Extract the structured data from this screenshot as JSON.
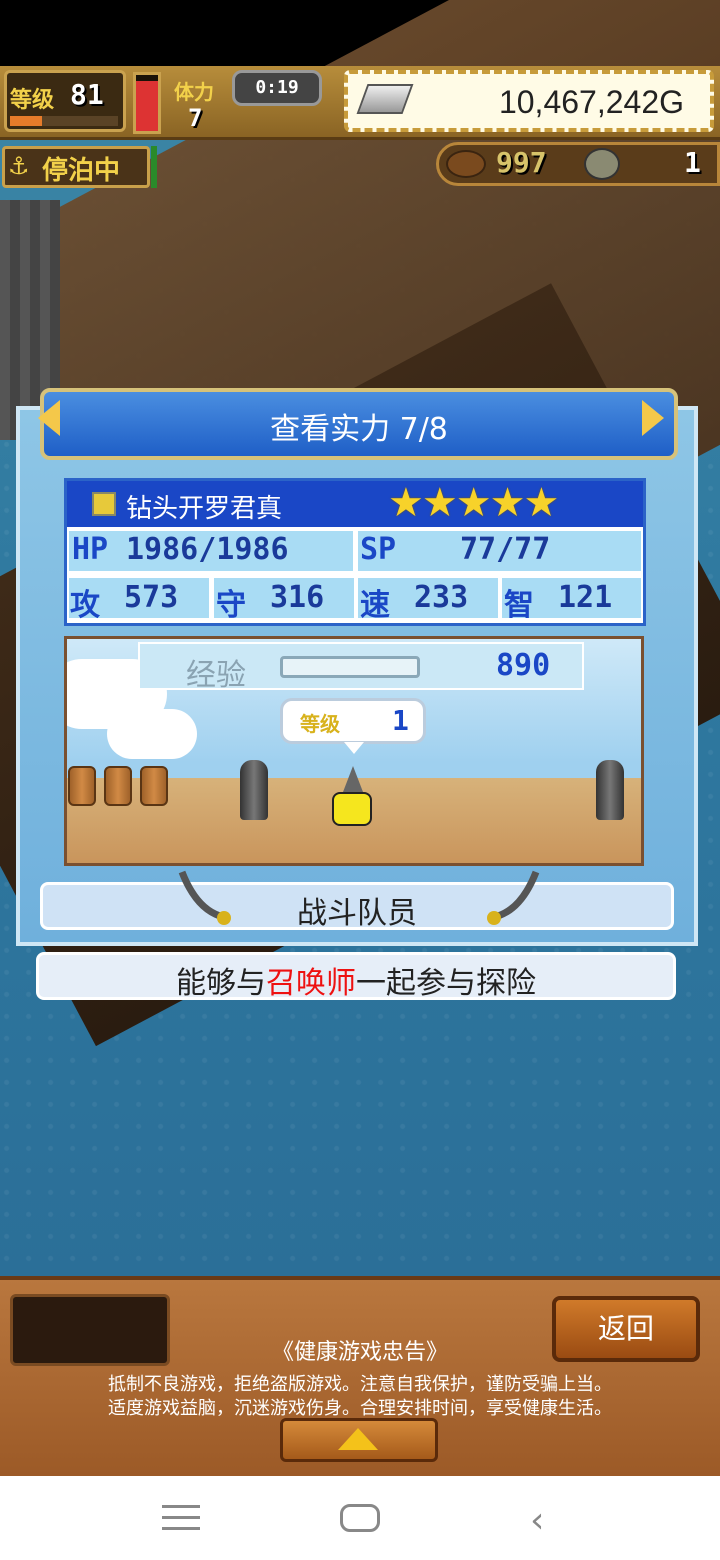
{
  "hud": {
    "level_label": "等级",
    "level_value": "81",
    "level_progress": 0.3,
    "hp_fill": 0.9,
    "stamina_label": "体力",
    "stamina_value": "7",
    "timer": "0:19",
    "gold": "10,467,242G",
    "status": "停泊中",
    "resource1": "997",
    "resource2": "1"
  },
  "dialog": {
    "title": "查看实力 7/8",
    "character_name": "钻头开罗君真",
    "stars": "★★★★★",
    "stats": {
      "hp_label": "HP",
      "hp_value": "1986/1986",
      "sp_label": "SP",
      "sp_value": "77/77",
      "atk_label": "攻",
      "atk_value": "573",
      "def_label": "守",
      "def_value": "316",
      "spd_label": "速",
      "spd_value": "233",
      "int_label": "智",
      "int_value": "121"
    },
    "exp_label": "经验",
    "exp_value": "890",
    "exp_progress": 0.0,
    "bubble_label": "等级",
    "bubble_level": "1",
    "team_label": "战斗队员",
    "desc_prefix": "能够与",
    "desc_highlight": "召唤师",
    "desc_suffix": "一起参与探险"
  },
  "footer": {
    "back_label": "返回",
    "health_title": "《健康游戏忠告》",
    "health_line1": "抵制不良游戏，拒绝盗版游戏。注意自我保护，谨防受骗上当。",
    "health_line2": "适度游戏益脑，沉迷游戏伤身。合理安排时间，享受健康生活。"
  },
  "icons": {
    "anchor": "⚓",
    "nav_back": "‹"
  },
  "colors": {
    "star": "#f7d22a",
    "highlight": "#e11111",
    "stat_blue": "#1a47c6"
  }
}
